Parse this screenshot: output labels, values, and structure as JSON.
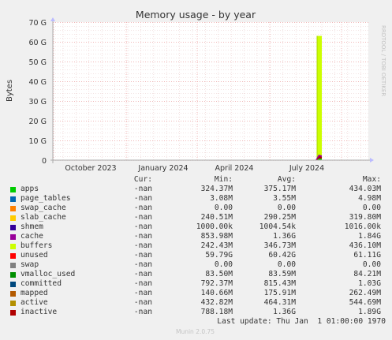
{
  "chart_data": {
    "type": "area",
    "title": "Memory usage - by year",
    "ylabel": "Bytes",
    "ylim": [
      0,
      70000000000
    ],
    "y_ticks": [
      "0",
      "10 G",
      "20 G",
      "30 G",
      "40 G",
      "50 G",
      "60 G",
      "70 G"
    ],
    "x_ticks": [
      "October 2023",
      "January 2024",
      "April 2024",
      "July 2024"
    ],
    "grid": true,
    "spike": {
      "position_label": "late July 2024",
      "unused_top": 63000000000,
      "base_top": 2800000000
    },
    "side_label": "RRDTOOL / TOBI OETIKER"
  },
  "legend": {
    "headers": {
      "cur": "Cur:",
      "min": "Min:",
      "avg": "Avg:",
      "max": "Max:"
    },
    "series": [
      {
        "name": "apps",
        "color": "#00cc00",
        "cur": "-nan",
        "min": "324.37M",
        "avg": "375.17M",
        "max": "434.03M"
      },
      {
        "name": "page_tables",
        "color": "#0066b3",
        "cur": "-nan",
        "min": "3.08M",
        "avg": "3.55M",
        "max": "4.98M"
      },
      {
        "name": "swap_cache",
        "color": "#ff8000",
        "cur": "-nan",
        "min": "0.00",
        "avg": "0.00",
        "max": "0.00"
      },
      {
        "name": "slab_cache",
        "color": "#ffcc00",
        "cur": "-nan",
        "min": "240.51M",
        "avg": "290.25M",
        "max": "319.80M"
      },
      {
        "name": "shmem",
        "color": "#330099",
        "cur": "-nan",
        "min": "1000.00k",
        "avg": "1004.54k",
        "max": "1016.00k"
      },
      {
        "name": "cache",
        "color": "#990099",
        "cur": "-nan",
        "min": "853.98M",
        "avg": "1.36G",
        "max": "1.84G"
      },
      {
        "name": "buffers",
        "color": "#ccff00",
        "cur": "-nan",
        "min": "242.43M",
        "avg": "346.73M",
        "max": "436.10M"
      },
      {
        "name": "unused",
        "color": "#ff0000",
        "cur": "-nan",
        "min": "59.79G",
        "avg": "60.42G",
        "max": "61.11G"
      },
      {
        "name": "swap",
        "color": "#808080",
        "cur": "-nan",
        "min": "0.00",
        "avg": "0.00",
        "max": "0.00"
      },
      {
        "name": "vmalloc_used",
        "color": "#008f00",
        "cur": "-nan",
        "min": "83.50M",
        "avg": "83.59M",
        "max": "84.21M"
      },
      {
        "name": "committed",
        "color": "#00487d",
        "cur": "-nan",
        "min": "792.37M",
        "avg": "815.43M",
        "max": "1.03G"
      },
      {
        "name": "mapped",
        "color": "#b35a00",
        "cur": "-nan",
        "min": "140.66M",
        "avg": "175.91M",
        "max": "262.49M"
      },
      {
        "name": "active",
        "color": "#b38f00",
        "cur": "-nan",
        "min": "432.82M",
        "avg": "464.31M",
        "max": "544.69M"
      },
      {
        "name": "inactive",
        "color": "#6b006b",
        "cur": "-nan",
        "min": "788.18M",
        "avg": "1.36G",
        "max": "1.89G"
      }
    ]
  },
  "swatch_colors": [
    "#00cc00",
    "#0066b3",
    "#ff8000",
    "#ffcc00",
    "#330099",
    "#990099",
    "#ccff00",
    "#ff0000",
    "#808080",
    "#008f00",
    "#00487d",
    "#b35a00",
    "#b38f00",
    "#b00000"
  ],
  "footer": {
    "last_update": "Last update: Thu Jan  1 01:00:00 1970",
    "munin": "Munin 2.0.75"
  }
}
